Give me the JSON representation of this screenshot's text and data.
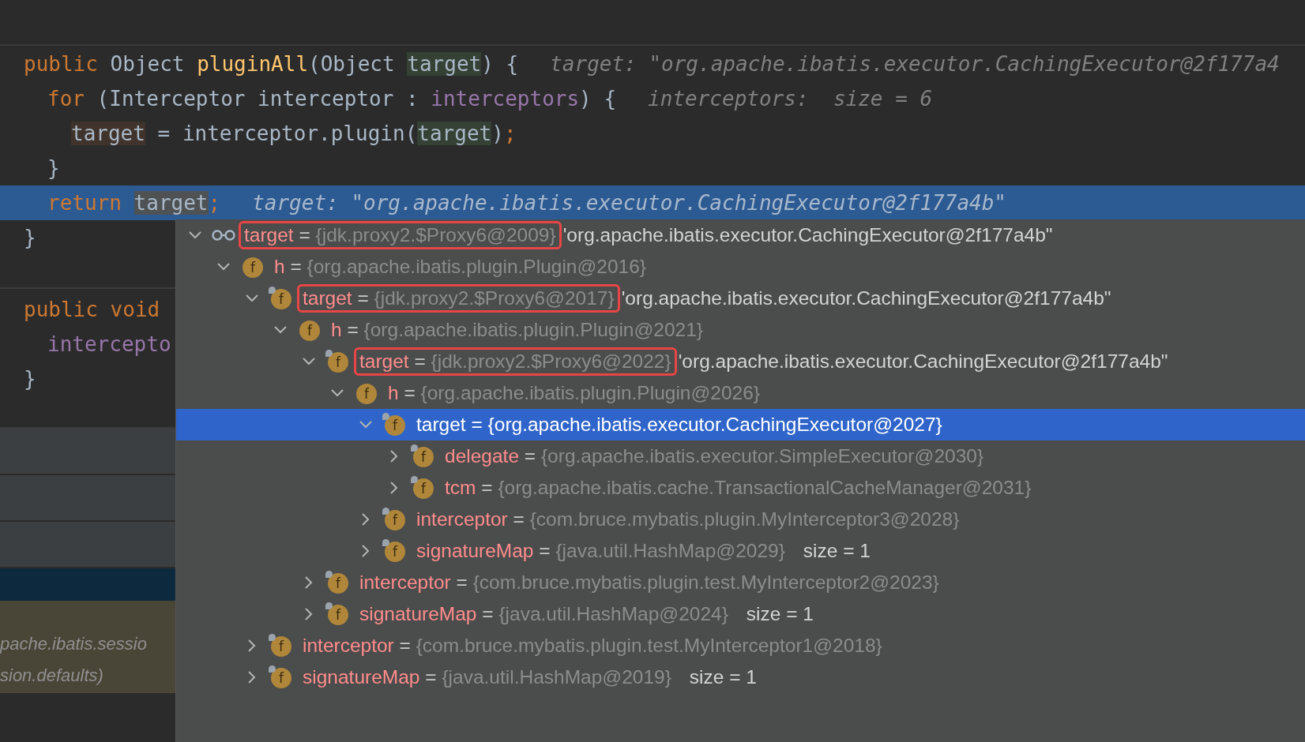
{
  "editor": {
    "lines": [
      {
        "kind": "declaration",
        "current": false,
        "tokens": [
          {
            "kind": "kw",
            "text": "public"
          },
          {
            "kind": "plain",
            "text": " Object "
          },
          {
            "kind": "method",
            "text": "pluginAll"
          },
          {
            "kind": "plain",
            "text": "(Object "
          },
          {
            "kind": "usage",
            "text": "target"
          },
          {
            "kind": "plain",
            "text": ") {"
          }
        ],
        "hint": "target: \"org.apache.ibatis.executor.CachingExecutor@2f177a4"
      },
      {
        "kind": "block",
        "current": false,
        "tokens": [
          {
            "kind": "kw",
            "text": "for"
          },
          {
            "kind": "plain",
            "text": " (Interceptor interceptor : "
          },
          {
            "kind": "field",
            "text": "interceptors"
          },
          {
            "kind": "plain",
            "text": ") {"
          }
        ],
        "hint": "interceptors:  size = 6"
      },
      {
        "kind": "nested",
        "current": false,
        "tokens": [
          {
            "kind": "write",
            "text": "target"
          },
          {
            "kind": "plain",
            "text": " = interceptor.plugin("
          },
          {
            "kind": "usage",
            "text": "target"
          },
          {
            "kind": "plain",
            "text": ")"
          },
          {
            "kind": "kw",
            "text": ";"
          }
        ]
      },
      {
        "kind": "block",
        "current": false,
        "tokens": [
          {
            "kind": "plain",
            "text": "}"
          }
        ]
      },
      {
        "kind": "block",
        "current": true,
        "tokens": [
          {
            "kind": "kw",
            "text": "return "
          },
          {
            "kind": "ref",
            "text": "target"
          },
          {
            "kind": "kw",
            "text": ";"
          }
        ],
        "hint": "target: \"org.apache.ibatis.executor.CachingExecutor@2f177a4b\""
      },
      {
        "kind": "declaration",
        "current": false,
        "tokens": [
          {
            "kind": "plain",
            "text": "}"
          }
        ]
      }
    ],
    "lines_below": [
      {
        "kind": "declaration",
        "current": false,
        "tokens": [
          {
            "kind": "kw",
            "text": "public void"
          }
        ]
      },
      {
        "kind": "block",
        "current": false,
        "tokens": [
          {
            "kind": "field",
            "text": "intercepto"
          }
        ]
      },
      {
        "kind": "declaration",
        "current": false,
        "tokens": [
          {
            "kind": "plain",
            "text": "}"
          }
        ]
      }
    ]
  },
  "frames": [
    {
      "kind": "frame",
      "selected": false
    },
    {
      "kind": "frame",
      "selected": false
    },
    {
      "kind": "frame",
      "selected": false
    },
    {
      "kind": "frame",
      "selected": true
    },
    {
      "kind": "library",
      "selected": false,
      "lines": [
        "pache.ibatis.sessio",
        "sion.defaults)"
      ]
    }
  ],
  "variables": [
    {
      "kind": "watch",
      "name": "target",
      "op": "=",
      "value": "{jdk.proxy2.$Proxy6@2009}",
      "highlighted": true,
      "extra": "'org.apache.ibatis.executor.CachingExecutor@2f177a4b\"",
      "expanded": true,
      "selected": false,
      "children": [
        {
          "kind": "field",
          "badge": "f",
          "final": false,
          "name": "h",
          "op": "=",
          "value": "{org.apache.ibatis.plugin.Plugin@2016}",
          "highlighted": false,
          "expanded": true,
          "selected": false,
          "children": [
            {
              "kind": "field",
              "badge": "f",
              "final": true,
              "name": "target",
              "op": "=",
              "value": "{jdk.proxy2.$Proxy6@2017}",
              "highlighted": true,
              "extra": "'org.apache.ibatis.executor.CachingExecutor@2f177a4b\"",
              "expanded": true,
              "selected": false,
              "children": [
                {
                  "kind": "field",
                  "badge": "f",
                  "final": false,
                  "name": "h",
                  "op": "=",
                  "value": "{org.apache.ibatis.plugin.Plugin@2021}",
                  "highlighted": false,
                  "expanded": true,
                  "selected": false,
                  "children": [
                    {
                      "kind": "field",
                      "badge": "f",
                      "final": true,
                      "name": "target",
                      "op": "=",
                      "value": "{jdk.proxy2.$Proxy6@2022}",
                      "highlighted": true,
                      "extra": "'org.apache.ibatis.executor.CachingExecutor@2f177a4b\"",
                      "expanded": true,
                      "selected": false,
                      "children": [
                        {
                          "kind": "field",
                          "badge": "f",
                          "final": false,
                          "name": "h",
                          "op": "=",
                          "value": "{org.apache.ibatis.plugin.Plugin@2026}",
                          "highlighted": false,
                          "expanded": true,
                          "selected": false,
                          "children": [
                            {
                              "kind": "field",
                              "badge": "f",
                              "final": true,
                              "name": "target",
                              "op": "=",
                              "value": "{org.apache.ibatis.executor.CachingExecutor@2027}",
                              "highlighted": false,
                              "expanded": true,
                              "selected": true,
                              "children": [
                                {
                                  "kind": "field",
                                  "badge": "f",
                                  "final": true,
                                  "name": "delegate",
                                  "op": "=",
                                  "value": "{org.apache.ibatis.executor.SimpleExecutor@2030}",
                                  "highlighted": false,
                                  "expanded": false,
                                  "selected": false
                                },
                                {
                                  "kind": "field",
                                  "badge": "f",
                                  "final": true,
                                  "name": "tcm",
                                  "op": "=",
                                  "value": "{org.apache.ibatis.cache.TransactionalCacheManager@2031}",
                                  "highlighted": false,
                                  "expanded": false,
                                  "selected": false
                                }
                              ]
                            },
                            {
                              "kind": "field",
                              "badge": "f",
                              "final": true,
                              "name": "interceptor",
                              "op": "=",
                              "value": "{com.bruce.mybatis.plugin.MyInterceptor3@2028}",
                              "highlighted": false,
                              "expanded": false,
                              "selected": false
                            },
                            {
                              "kind": "field",
                              "badge": "f",
                              "final": true,
                              "name": "signatureMap",
                              "op": "=",
                              "value": "{java.util.HashMap@2029}",
                              "size": "size = 1",
                              "highlighted": false,
                              "expanded": false,
                              "selected": false
                            }
                          ]
                        }
                      ]
                    },
                    {
                      "kind": "field",
                      "badge": "f",
                      "final": true,
                      "name": "interceptor",
                      "op": "=",
                      "value": "{com.bruce.mybatis.plugin.test.MyInterceptor2@2023}",
                      "highlighted": false,
                      "expanded": false,
                      "selected": false
                    },
                    {
                      "kind": "field",
                      "badge": "f",
                      "final": true,
                      "name": "signatureMap",
                      "op": "=",
                      "value": "{java.util.HashMap@2024}",
                      "size": "size = 1",
                      "highlighted": false,
                      "expanded": false,
                      "selected": false
                    }
                  ]
                }
              ]
            },
            {
              "kind": "field",
              "badge": "f",
              "final": true,
              "name": "interceptor",
              "op": "=",
              "value": "{com.bruce.mybatis.plugin.test.MyInterceptor1@2018}",
              "highlighted": false,
              "expanded": false,
              "selected": false
            },
            {
              "kind": "field",
              "badge": "f",
              "final": true,
              "name": "signatureMap",
              "op": "=",
              "value": "{java.util.HashMap@2019}",
              "size": "size = 1",
              "highlighted": false,
              "expanded": false,
              "selected": false
            }
          ]
        }
      ]
    }
  ]
}
